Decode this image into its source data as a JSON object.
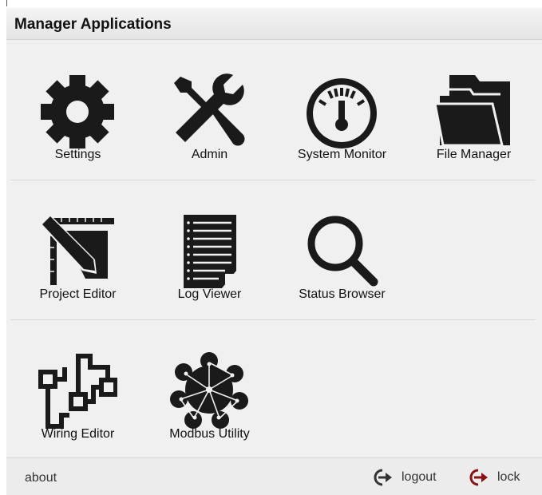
{
  "header": {
    "title": "Manager Applications"
  },
  "apps": [
    {
      "label": "Settings",
      "icon": "gear-icon"
    },
    {
      "label": "Admin",
      "icon": "tools-icon"
    },
    {
      "label": "System Monitor",
      "icon": "gauge-icon"
    },
    {
      "label": "File Manager",
      "icon": "folder-icon"
    },
    {
      "label": "Project Editor",
      "icon": "drafting-pencil-icon"
    },
    {
      "label": "Log Viewer",
      "icon": "document-icon"
    },
    {
      "label": "Status Browser",
      "icon": "magnifier-icon"
    },
    {
      "label": "Wiring Editor",
      "icon": "wiring-icon"
    },
    {
      "label": "Modbus Utility",
      "icon": "network-blob-icon"
    }
  ],
  "footer": {
    "about": "about",
    "logout": "logout",
    "lock": "lock"
  },
  "colors": {
    "icon": "#1a1a1a",
    "logout_icon": "#333333",
    "lock_icon": "#8b1010",
    "background": "#f0f0f0"
  }
}
